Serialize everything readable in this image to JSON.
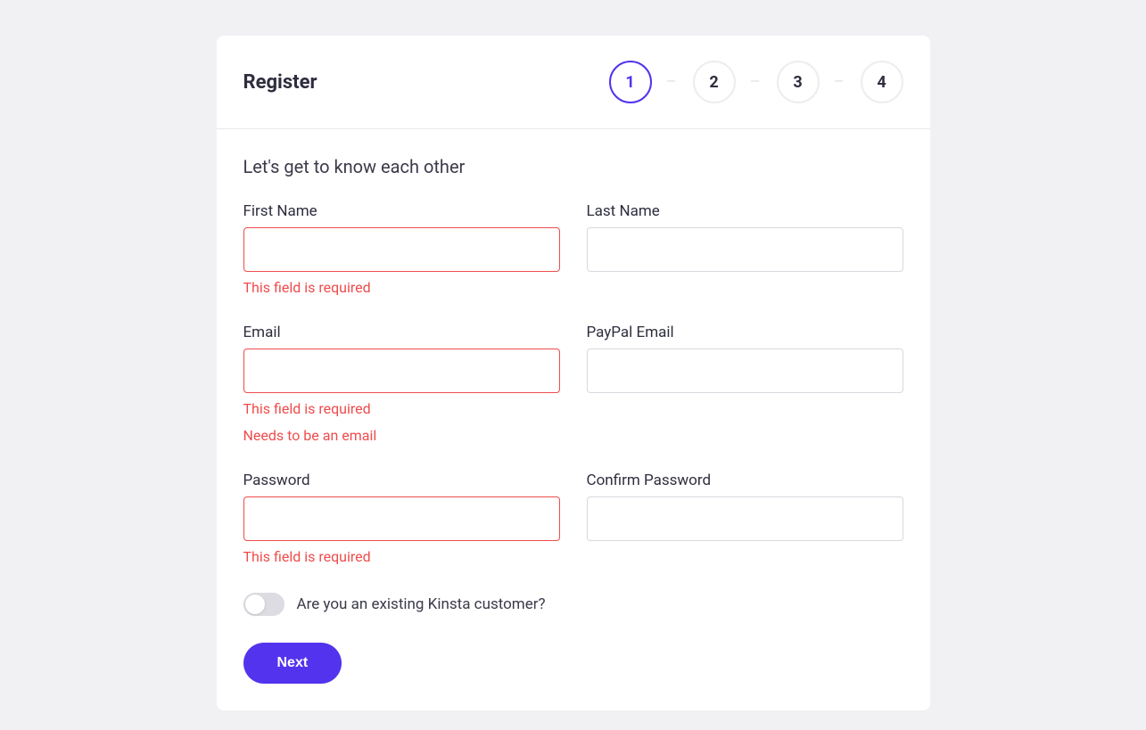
{
  "title": "Register",
  "steps": [
    "1",
    "2",
    "3",
    "4"
  ],
  "subheading": "Let's get to know each other",
  "fields": {
    "first_name": {
      "label": "First Name",
      "value": "",
      "errors": [
        "This field is required"
      ]
    },
    "last_name": {
      "label": "Last Name",
      "value": ""
    },
    "email": {
      "label": "Email",
      "value": "",
      "errors": [
        "This field is required",
        "Needs to be an email"
      ]
    },
    "paypal_email": {
      "label": "PayPal Email",
      "value": ""
    },
    "password": {
      "label": "Password",
      "value": "",
      "errors": [
        "This field is required"
      ]
    },
    "confirm_password": {
      "label": "Confirm Password",
      "value": ""
    }
  },
  "toggle": {
    "label": "Are you an existing Kinsta customer?",
    "checked": false
  },
  "next_button": "Next",
  "colors": {
    "accent": "#5333ed",
    "error": "#ef4c4c"
  }
}
